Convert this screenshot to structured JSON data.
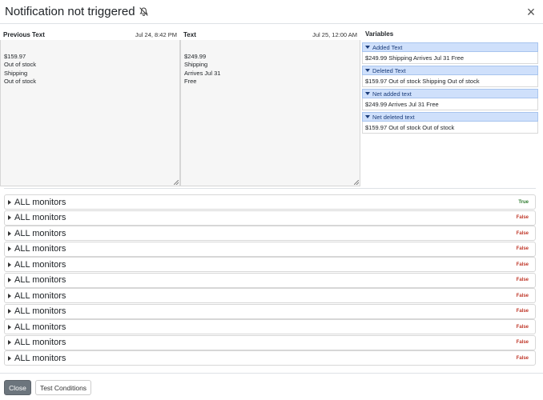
{
  "modal": {
    "title": "Notification not triggered",
    "close_symbol": "×",
    "title_icon": "bell-slash-icon"
  },
  "previous": {
    "label": "Previous Text",
    "timestamp": "Jul 24, 8:42 PM",
    "content": "$159.97\nOut of stock\n Shipping\nOut of stock"
  },
  "current": {
    "label": "Text",
    "timestamp": "Jul 25, 12:00 AM",
    "content": "$249.99\n Shipping\nArrives Jul 31\nFree"
  },
  "variables": {
    "title": "Variables",
    "groups": [
      {
        "name": "Added Text",
        "value": "$249.99 Shipping Arrives Jul 31 Free"
      },
      {
        "name": "Deleted Text",
        "value": "$159.97 Out of stock Shipping Out of stock"
      },
      {
        "name": "Net added text",
        "value": "$249.99 Arrives Jul 31 Free"
      },
      {
        "name": "Net deleted text",
        "value": "$159.97 Out of stock Out of stock"
      }
    ]
  },
  "monitors": [
    {
      "label": "ALL monitors",
      "result": "True"
    },
    {
      "label": "ALL monitors",
      "result": "False"
    },
    {
      "label": "ALL monitors",
      "result": "False"
    },
    {
      "label": "ALL monitors",
      "result": "False"
    },
    {
      "label": "ALL monitors",
      "result": "False"
    },
    {
      "label": "ALL monitors",
      "result": "False"
    },
    {
      "label": "ALL monitors",
      "result": "False"
    },
    {
      "label": "ALL monitors",
      "result": "False"
    },
    {
      "label": "ALL monitors",
      "result": "False"
    },
    {
      "label": "ALL monitors",
      "result": "False"
    },
    {
      "label": "ALL monitors",
      "result": "False"
    }
  ],
  "footer": {
    "close_label": "Close",
    "test_label": "Test Conditions"
  },
  "colors": {
    "true": "#2c7a2c",
    "false": "#c0392b",
    "variable_header": "#cfe0fb"
  }
}
